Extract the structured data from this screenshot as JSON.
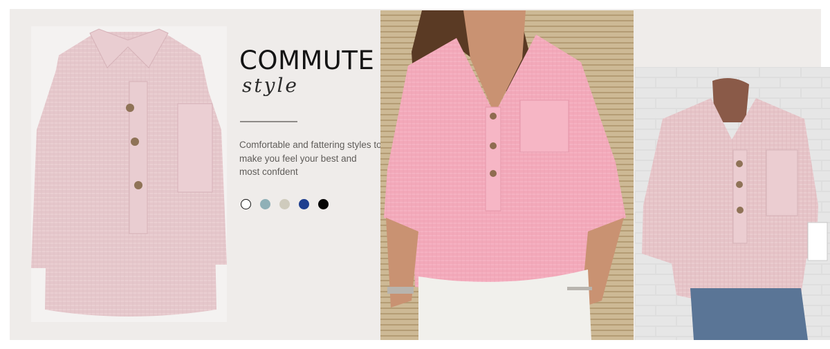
{
  "promo": {
    "headline": "COMMUTE",
    "script": "style",
    "description_lines": [
      "Comfortable and fattering styles to",
      "make you feel your best and",
      "most confdent"
    ]
  },
  "swatches": [
    {
      "name": "white",
      "color": "#ffffff",
      "border": "#111111"
    },
    {
      "name": "light-blue",
      "color": "#8fb0b7",
      "border": "#8fb0b7"
    },
    {
      "name": "beige",
      "color": "#cfcbbd",
      "border": "#cfcbbd"
    },
    {
      "name": "navy",
      "color": "#1f3f8f",
      "border": "#1f3f8f"
    },
    {
      "name": "black",
      "color": "#050505",
      "border": "#050505"
    }
  ],
  "colors": {
    "banner_bg": "#efecea",
    "shirt_pink": "#f2a9b9",
    "shirt_pale_pink": "#e7c6cb"
  },
  "images": [
    {
      "name": "product-flatlay-photo"
    },
    {
      "name": "model-wearing-shirt-photo"
    },
    {
      "name": "mannequin-shirt-photo"
    }
  ]
}
